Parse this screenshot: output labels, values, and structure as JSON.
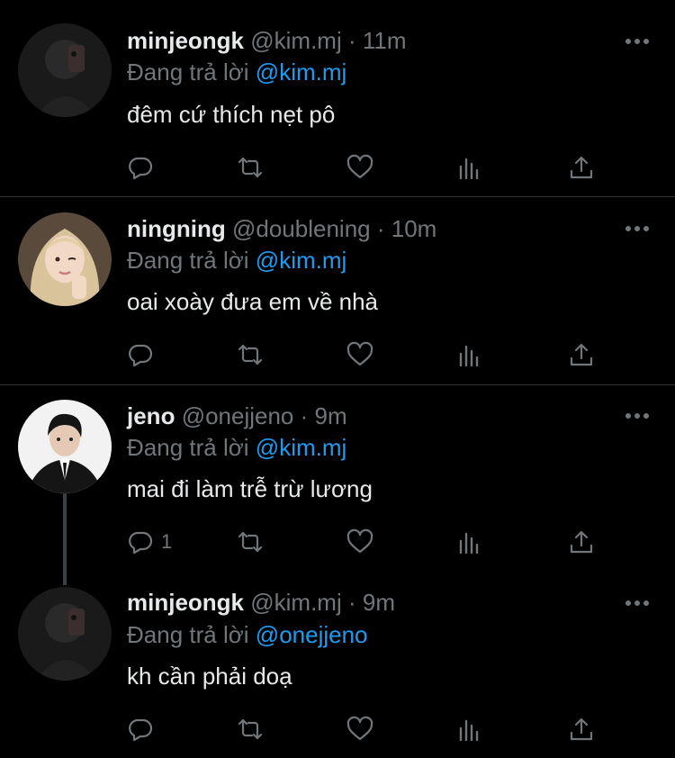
{
  "reply_prefix": "Đang trả lời",
  "tweets": [
    {
      "name": "minjeongk",
      "handle": "@kim.mj",
      "dot": "·",
      "time": "11m",
      "reply_to": "@kim.mj",
      "text": "đêm cứ thích nẹt pô",
      "reply_count": "",
      "avatar": "dark-mirror-selfie"
    },
    {
      "name": "ningning",
      "handle": "@doublening",
      "dot": "·",
      "time": "10m",
      "reply_to": "@kim.mj",
      "text": "oai xoày đưa em về nhà",
      "reply_count": "",
      "avatar": "blonde-girl"
    },
    {
      "name": "jeno",
      "handle": "@onejjeno",
      "dot": "·",
      "time": "9m",
      "reply_to": "@kim.mj",
      "text": "mai đi làm trễ trừ lương",
      "reply_count": "1",
      "avatar": "man-in-suit"
    },
    {
      "name": "minjeongk",
      "handle": "@kim.mj",
      "dot": "·",
      "time": "9m",
      "reply_to": "@onejjeno",
      "text": "kh cần phải doạ",
      "reply_count": "",
      "avatar": "dark-mirror-selfie"
    }
  ],
  "colors": {
    "background": "#000000",
    "text": "#e7e9ea",
    "muted": "#71767b",
    "mention": "#1d9bf0",
    "divider": "#2f3336"
  }
}
